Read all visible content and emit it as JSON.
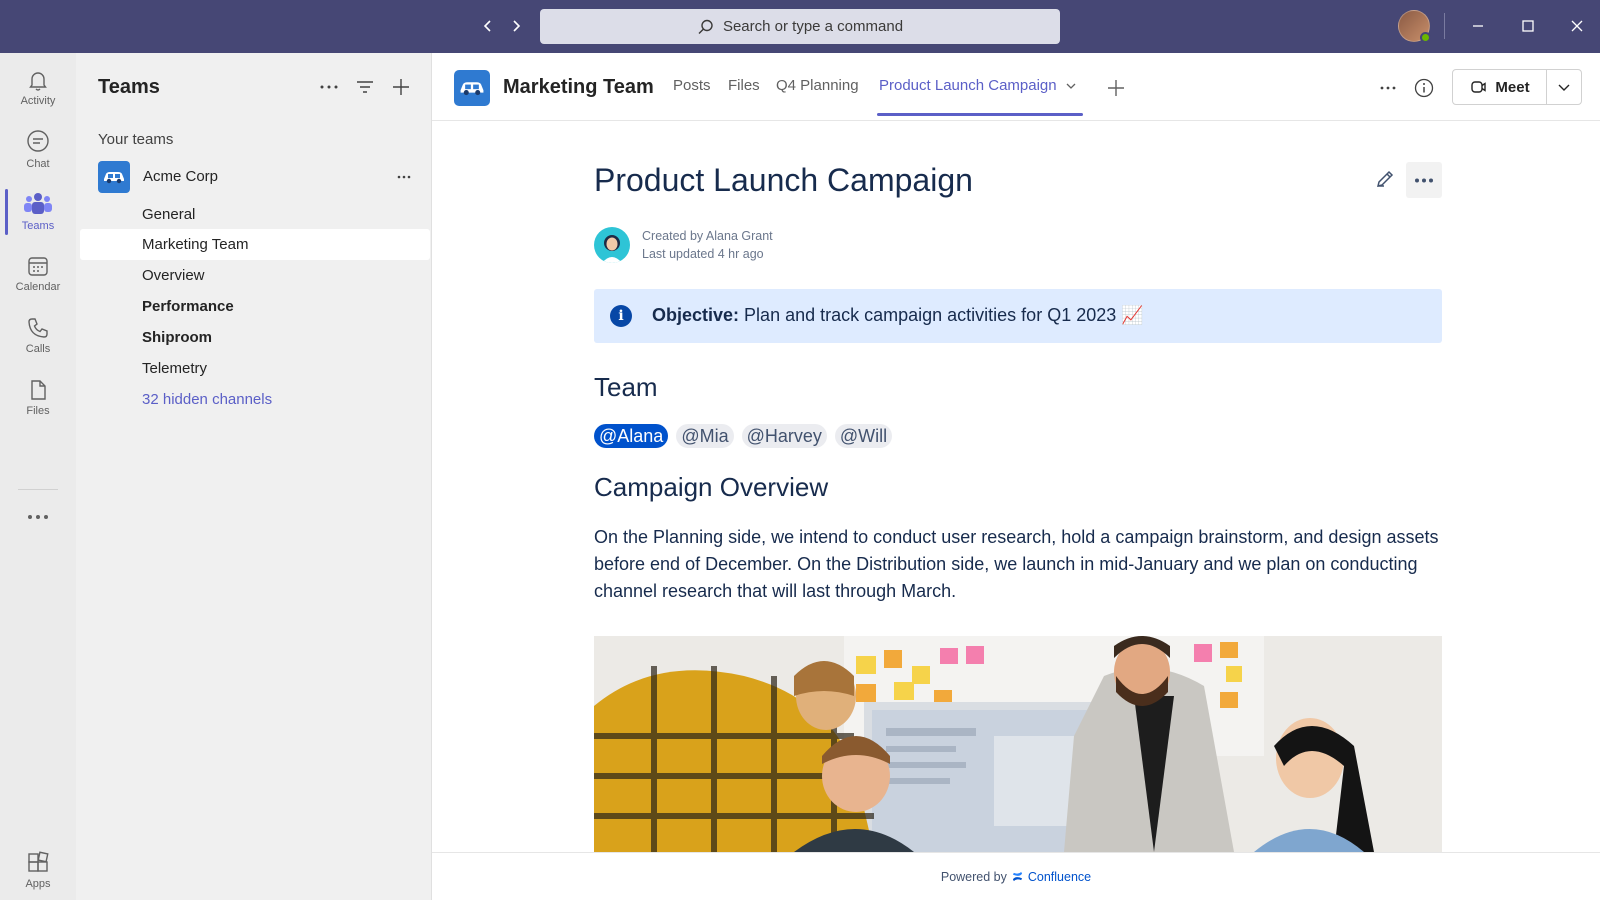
{
  "titlebar": {
    "search_placeholder": "Search or type a command",
    "accent": "#464775",
    "icons": [
      "back-arrow-icon",
      "forward-arrow-icon",
      "search-icon",
      "minimize-icon",
      "maximize-icon",
      "close-icon"
    ]
  },
  "rail": {
    "items": [
      {
        "label": "Activity",
        "icon": "bell-icon"
      },
      {
        "label": "Chat",
        "icon": "chat-icon"
      },
      {
        "label": "Teams",
        "icon": "teams-icon",
        "active": true
      },
      {
        "label": "Calendar",
        "icon": "calendar-icon"
      },
      {
        "label": "Calls",
        "icon": "phone-icon"
      },
      {
        "label": "Files",
        "icon": "file-icon"
      }
    ],
    "apps_label": "Apps"
  },
  "pane": {
    "title": "Teams",
    "section_label": "Your teams",
    "team": {
      "name": "Acme Corp",
      "channels": [
        {
          "label": "General",
          "style": "normal"
        },
        {
          "label": "Marketing Team",
          "style": "selected"
        },
        {
          "label": "Overview",
          "style": "normal"
        },
        {
          "label": "Performance",
          "style": "bold"
        },
        {
          "label": "Shiproom",
          "style": "bold"
        },
        {
          "label": "Telemetry",
          "style": "normal"
        },
        {
          "label": "32 hidden channels",
          "style": "link"
        }
      ]
    }
  },
  "header": {
    "title": "Marketing Team",
    "tabs": [
      {
        "label": "Posts"
      },
      {
        "label": "Files"
      },
      {
        "label": "Q4 Planning"
      },
      {
        "label": "Product Launch Campaign",
        "active": true
      }
    ],
    "meet_label": "Meet",
    "accent": "#5b5fc7"
  },
  "page": {
    "title": "Product Launch Campaign",
    "created_by": "Created by Alana Grant",
    "last_updated": "Last updated 4 hr ago",
    "objective_label": "Objective:",
    "objective_text": "Plan and track campaign activities for Q1 2023 📈",
    "team_heading": "Team",
    "mentions": [
      "@Alana",
      "@Mia",
      "@Harvey",
      "@Will"
    ],
    "overview_heading": "Campaign Overview",
    "overview_text": "On the Planning side, we intend to conduct user research, hold a campaign brainstorm, and design assets before end of December. On the Distribution side, we launch in mid-January and we plan on conducting channel research that will last through March.",
    "info_color": "#deebff",
    "mention_self_color": "#0052cc"
  },
  "footer": {
    "powered_by": "Powered by",
    "brand": "Confluence"
  }
}
